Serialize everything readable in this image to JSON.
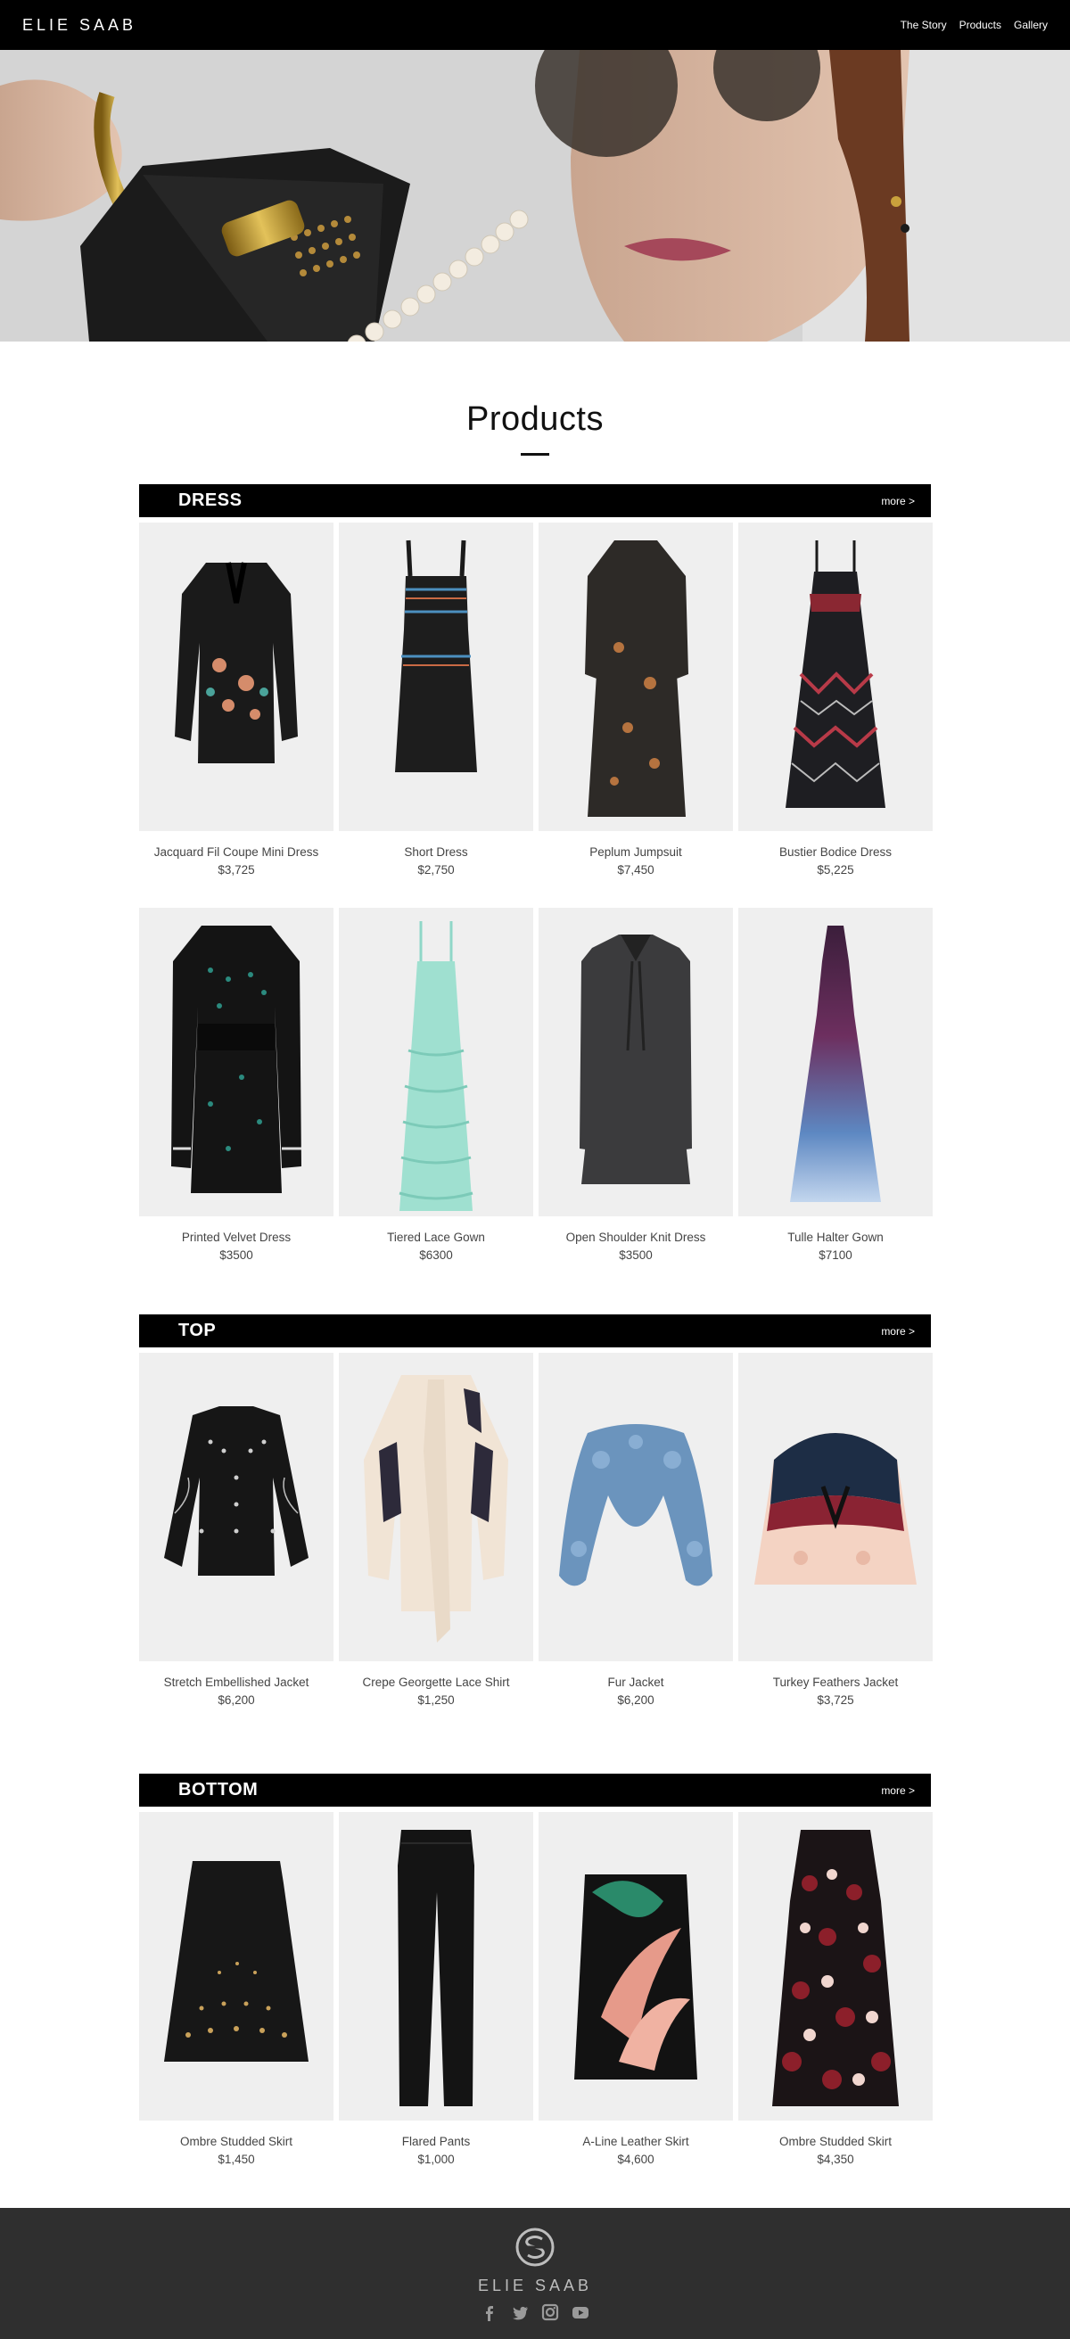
{
  "header": {
    "brand": "ELIE SAAB",
    "nav": [
      "The Story",
      "Products",
      "Gallery"
    ]
  },
  "page_title": "Products",
  "categories": [
    {
      "name": "DRESS",
      "more": "more >",
      "rows": [
        [
          {
            "name": "Jacquard Fil Coupe Mini Dress",
            "price": "$3,725"
          },
          {
            "name": "Short Dress",
            "price": "$2,750"
          },
          {
            "name": "Peplum Jumpsuit",
            "price": "$7,450"
          },
          {
            "name": "Bustier Bodice Dress",
            "price": "$5,225"
          }
        ],
        [
          {
            "name": "Printed Velvet Dress",
            "price": "$3500"
          },
          {
            "name": "Tiered Lace Gown",
            "price": "$6300"
          },
          {
            "name": "Open Shoulder Knit Dress",
            "price": "$3500"
          },
          {
            "name": "Tulle Halter Gown",
            "price": "$7100"
          }
        ]
      ]
    },
    {
      "name": "TOP",
      "more": "more >",
      "rows": [
        [
          {
            "name": "Stretch Embellished Jacket",
            "price": "$6,200"
          },
          {
            "name": "Crepe Georgette Lace Shirt",
            "price": "$1,250"
          },
          {
            "name": "Fur Jacket",
            "price": "$6,200"
          },
          {
            "name": "Turkey Feathers Jacket",
            "price": "$3,725"
          }
        ]
      ]
    },
    {
      "name": "BOTTOM",
      "more": "more >",
      "rows": [
        [
          {
            "name": "Ombre Studded Skirt",
            "price": "$1,450"
          },
          {
            "name": "Flared Pants",
            "price": "$1,000"
          },
          {
            "name": "A-Line Leather Skirt",
            "price": "$4,600"
          },
          {
            "name": "Ombre Studded Skirt",
            "price": "$4,350"
          }
        ]
      ]
    }
  ],
  "footer": {
    "brand": "ELIE SAAB",
    "social_icons": [
      "facebook-icon",
      "twitter-icon",
      "instagram-icon",
      "youtube-icon"
    ]
  },
  "colors": {
    "header_bg": "#000000",
    "card_bg": "#efefef",
    "footer_bg": "#2f2f2f"
  }
}
